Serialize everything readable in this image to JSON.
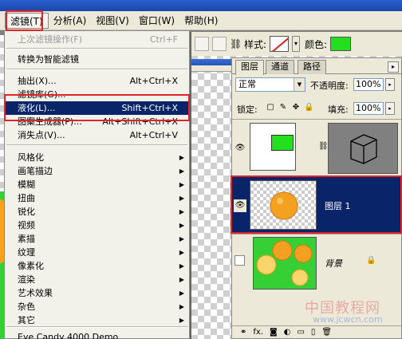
{
  "menubar": {
    "items": [
      "滤镜(T)",
      "分析(A)",
      "视图(V)",
      "窗口(W)",
      "帮助(H)"
    ]
  },
  "filter_menu": {
    "last_filter": {
      "label": "上次滤镜操作(F)",
      "shortcut": "Ctrl+F"
    },
    "convert_smart": "转换为智能滤镜",
    "extract": {
      "label": "抽出(X)...",
      "shortcut": "Alt+Ctrl+X"
    },
    "gallery": "滤镜库(G)...",
    "liquify": {
      "label": "液化(L)...",
      "shortcut": "Shift+Ctrl+X"
    },
    "pattern_maker": {
      "label": "图案生成器(P)...",
      "shortcut": "Alt+Shift+Ctrl+X"
    },
    "vanishing_point": {
      "label": "消失点(V)...",
      "shortcut": "Alt+Ctrl+V"
    },
    "submenus": [
      "风格化",
      "画笔描边",
      "模糊",
      "扭曲",
      "锐化",
      "视频",
      "素描",
      "纹理",
      "像素化",
      "渲染",
      "艺术效果",
      "杂色",
      "其它"
    ],
    "plugin": "Eye Candy 4000 Demo"
  },
  "options_bar": {
    "style_label": "样式:",
    "color_label": "颜色:",
    "color": "#22e01e"
  },
  "layers_panel": {
    "tabs": [
      "图层",
      "通道",
      "路径"
    ],
    "blend_mode": "正常",
    "opacity_label": "不透明度:",
    "opacity": "100%",
    "lock_label": "锁定:",
    "fill_label": "填充:",
    "fill": "100%",
    "layers": [
      {
        "name": "",
        "visible": true,
        "type": "shape"
      },
      {
        "name": "图层 1",
        "visible": true,
        "selected": true
      },
      {
        "name": "背景",
        "visible": false,
        "locked": true
      }
    ],
    "footer_icons": [
      "link-icon",
      "fx-icon",
      "mask-icon",
      "adjustment-icon",
      "group-icon",
      "new-layer-icon",
      "trash-icon"
    ]
  },
  "watermark": {
    "cn": "中国教程网",
    "url": "www.jcwcn.com"
  },
  "colors": {
    "highlight": "#0a246a",
    "annotation": "#e2242a",
    "green": "#22e01e"
  }
}
